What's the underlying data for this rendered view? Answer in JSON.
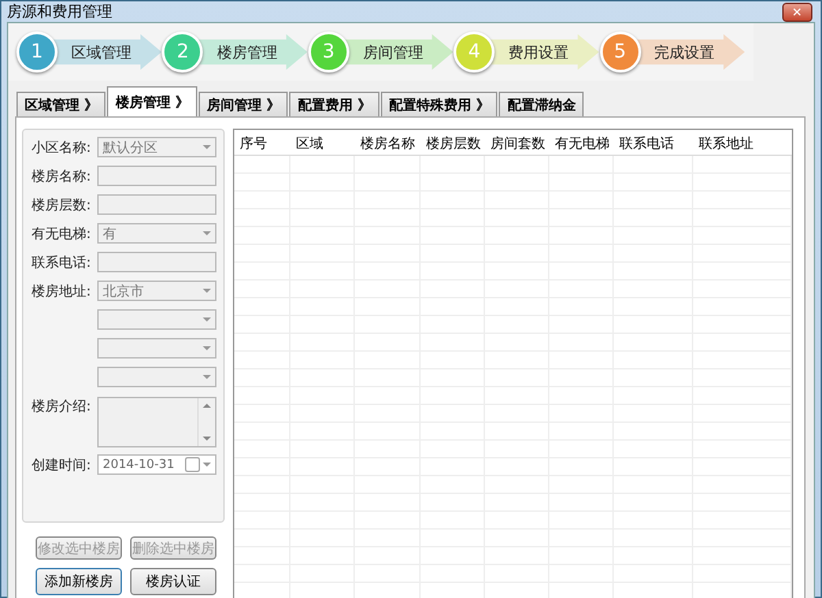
{
  "window": {
    "title": "房源和费用管理",
    "close": "✕"
  },
  "steps": [
    {
      "number": "1",
      "label": "区域管理",
      "color": "#3fa7c8"
    },
    {
      "number": "2",
      "label": "楼房管理",
      "color": "#3ccf8e"
    },
    {
      "number": "3",
      "label": "房间管理",
      "color": "#55d63c"
    },
    {
      "number": "4",
      "label": "费用设置",
      "color": "#cfe03a"
    },
    {
      "number": "5",
      "label": "完成设置",
      "color": "#f08a3c"
    }
  ],
  "tabs": [
    {
      "label": "区域管理 》",
      "selected": false
    },
    {
      "label": "楼房管理 》",
      "selected": true
    },
    {
      "label": "房间管理 》",
      "selected": false
    },
    {
      "label": "配置费用 》",
      "selected": false
    },
    {
      "label": "配置特殊费用 》",
      "selected": false
    },
    {
      "label": "配置滞纳金",
      "selected": false
    }
  ],
  "form": [
    {
      "kind": "combo",
      "label": "小区名称:",
      "value": "默认分区"
    },
    {
      "kind": "text",
      "label": "楼房名称:"
    },
    {
      "kind": "text",
      "label": "楼房层数:"
    },
    {
      "kind": "combo",
      "label": "有无电梯:",
      "value": "有"
    },
    {
      "kind": "text",
      "label": "联系电话:"
    },
    {
      "kind": "combo",
      "label": "楼房地址:",
      "value": "北京市"
    },
    {
      "kind": "combo"
    },
    {
      "kind": "combo"
    },
    {
      "kind": "combo"
    },
    {
      "kind": "textarea",
      "label": "楼房介绍:"
    },
    {
      "kind": "date",
      "label": "创建时间:",
      "value": "2014-10-31",
      "checked": false
    }
  ],
  "buttons": [
    {
      "label": "修改选中楼房",
      "disabled": true
    },
    {
      "label": "删除选中楼房",
      "disabled": true
    },
    {
      "label": "添加新楼房",
      "disabled": false
    },
    {
      "label": "楼房认证",
      "disabled": false
    }
  ],
  "table": {
    "columns": [
      "序号",
      "区域",
      "楼房名称",
      "楼房层数",
      "房间套数",
      "有无电梯",
      "联系电话",
      "联系地址"
    ]
  }
}
